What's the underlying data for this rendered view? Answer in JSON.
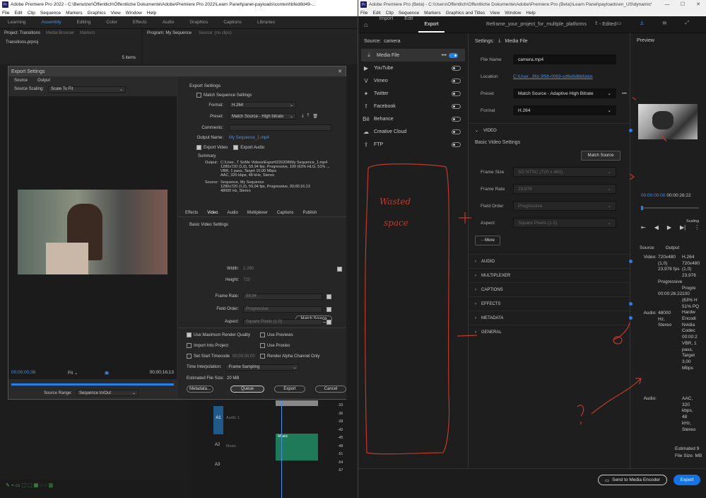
{
  "left_window": {
    "title": "Adobe Premiere Pro 2022 - C:\\Benutzer\\Öffentlich\\Öffentliche Dokumente\\Adobe\\Premiere Pro 2022\\Learn Panel\\panel-payloads\\content\\bfed8d49-...",
    "menu": [
      "File",
      "Edit",
      "Clip",
      "Sequence",
      "Markers",
      "Graphics",
      "View",
      "Window",
      "Help"
    ],
    "workspaces": [
      "Learning",
      "Assembly",
      "Editing",
      "Color",
      "Effects",
      "Audio",
      "Graphics",
      "Captions",
      "Libraries"
    ],
    "active_workspace": "Assembly",
    "project_tabs": [
      "Project: Transitions",
      "Media Browser",
      "Markers"
    ],
    "program_tabs": [
      "Program: My Sequence",
      "Source: (no clips)"
    ],
    "project_file": "Transitions.prproj",
    "items_count": "5 items",
    "export_dialog": {
      "title": "Export Settings",
      "tabs": [
        "Source",
        "Output"
      ],
      "source_scaling_label": "Source Scaling:",
      "source_scaling_value": "Scale To Fit",
      "timecode_left": "00;00;00;38",
      "fit": "Fit",
      "timecode_right": "00;00;16;13",
      "source_range_label": "Source Range:",
      "source_range_value": "Sequence In/Out",
      "export_settings_header": "Export Settings",
      "match_sequence": "Match Sequence Settings",
      "format_label": "Format:",
      "format_value": "H.264",
      "preset_label": "Preset:",
      "preset_value": "Match Source - High bitrate",
      "comments_label": "Comments:",
      "output_name_label": "Output Name:",
      "output_name_value": "My Sequence_1.mp4",
      "export_video": "Export Video",
      "export_audio": "Export Audio",
      "summary_header": "Summary",
      "output_label": "Output:",
      "output_lines": [
        "C:\\User...T SoMe Videos\\Export\\220208\\My Sequence_1.mp4",
        "1280x720 (1,0), 59,94 fps, Progressive, 100 (63% HLG, 51% ...",
        "VBR, 1 pass, Target 10,00 Mbps",
        "AAC, 320 kbps, 48 kHz, Stereo"
      ],
      "source_label": "Source:",
      "source_lines": [
        "Sequence, My Sequence",
        "1280x720 (1,0), 59,94 fps, Progressive, 00;00;16;13",
        "48000 Hz, Stereo"
      ],
      "settings_tabs": [
        "Effects",
        "Video",
        "Audio",
        "Multiplexer",
        "Captions",
        "Publish"
      ],
      "active_settings_tab": "Video",
      "basic_video_header": "Basic Video Settings",
      "match_source_btn": "Match Source",
      "width_label": "Width:",
      "width_value": "1.280",
      "height_label": "Height:",
      "height_value": "720",
      "frame_rate_label": "Frame Rate:",
      "frame_rate_value": "59,94",
      "field_order_label": "Field Order:",
      "field_order_value": "Progressive",
      "aspect_label": "Aspect:",
      "aspect_value": "Square Pixels (1.0)",
      "max_render": "Use Maximum Render Quality",
      "use_previews": "Use Previews",
      "import_project": "Import Into Project",
      "use_proxies": "Use Proxies",
      "set_start_tc": "Set Start Timecode",
      "start_tc_value": "00;00;00;00",
      "render_alpha": "Render Alpha Channel Only",
      "time_interp_label": "Time Interpolation:",
      "time_interp_value": "Frame Sampling",
      "file_size_label": "Estimated File Size:",
      "file_size_value": "20 MB",
      "buttons": [
        "Metadata...",
        "Queue",
        "Export",
        "Cancel"
      ]
    },
    "timeline": {
      "tracks": [
        "A1",
        "A2",
        "A3"
      ],
      "track_labels": [
        "Audio 1",
        "Music"
      ],
      "clip_label": "Music",
      "db_scale": [
        "-33",
        "-36",
        "-39",
        "-42",
        "-45",
        "-48",
        "-51",
        "-54",
        "-57"
      ]
    }
  },
  "right_window": {
    "title": "Adobe Premiere Pro (Beta) - C:\\Users\\Öffentlich\\Öffentliche Dokumente\\Adobe\\Premiere Pro (Beta)\\Learn Panel\\payloads\\en_US\\dynamic\\conte...",
    "menu": [
      "File",
      "Edit",
      "Clip",
      "Sequence",
      "Markers",
      "Graphics and Titles",
      "View",
      "Window",
      "Help"
    ],
    "tabs": [
      "Import",
      "Edit",
      "Export"
    ],
    "active_tab": "Export",
    "project_title": "Reframe_your_project_for_multiple_platforms",
    "edited_status": "- Edited",
    "source_label": "Source:",
    "source_value": "camera",
    "destinations": [
      {
        "label": "Media File",
        "icon": "download-icon",
        "on": true
      },
      {
        "label": "YouTube",
        "icon": "youtube-icon",
        "on": false
      },
      {
        "label": "Vimeo",
        "icon": "vimeo-icon",
        "on": false
      },
      {
        "label": "Twitter",
        "icon": "twitter-icon",
        "on": false
      },
      {
        "label": "Facebook",
        "icon": "facebook-icon",
        "on": false
      },
      {
        "label": "Behance",
        "icon": "behance-icon",
        "on": false
      },
      {
        "label": "Creative Cloud",
        "icon": "creative-cloud-icon",
        "on": false
      },
      {
        "label": "FTP",
        "icon": "ftp-icon",
        "on": false
      }
    ],
    "settings_label": "Settings:",
    "settings_value": "Media File",
    "file_name_label": "File Name",
    "file_name_value": "camera.mp4",
    "location_label": "Location",
    "location_value": "C:\\User...8fd-3f98-0083-cd6e6d8bfdda\\",
    "preset_label": "Preset",
    "preset_value": "Match Source - Adaptive High Bitrate",
    "format_label": "Format",
    "format_value": "H.264",
    "video_section": "VIDEO",
    "basic_video": "Basic Video Settings",
    "match_source": "Match Source",
    "frame_size_label": "Frame Size",
    "frame_size_value": "SD NTSC (720 x 480)",
    "frame_rate_label": "Frame Rate",
    "frame_rate_value": "23,976",
    "field_order_label": "Field Order",
    "field_order_value": "Progressive",
    "aspect_label": "Aspect",
    "aspect_value": "Square Pixels (1.0)",
    "more_btn": "More",
    "sections": [
      "AUDIO",
      "MULTIPLEXER",
      "CAPTIONS",
      "EFFECTS",
      "METADATA",
      "GENERAL"
    ],
    "preview_label": "Preview",
    "preview_tc_start": "00:00:00:00",
    "preview_tc_end": "00:00:26:22",
    "scaling_label": "Scaling",
    "summary_cols": [
      "Source",
      "Output"
    ],
    "video_label": "Video:",
    "src_video": [
      "720x480",
      "(1,0)",
      "23,976 fps",
      "",
      "Progressive",
      "",
      "00:00:26:22"
    ],
    "out_video": [
      "H.264",
      "720x480",
      "(1,0)",
      "23,976",
      "",
      "Progre",
      "100",
      "(63% H",
      "51% PQ",
      "Hardw",
      "Encodi",
      "Nvidia",
      "Codec",
      "00:00:2",
      "VBR, 1",
      "pass,",
      "Target",
      "3,00",
      "Mbps"
    ],
    "audio_label": "Audio:",
    "src_audio": [
      "48000",
      "Hz,",
      "Stereo"
    ],
    "out_audio": [
      "AAC,",
      "320",
      "kbps,",
      "48",
      "kHz,",
      "Stereo"
    ],
    "estimated_label": "Estimated",
    "estimated_value": "9",
    "filesize_label": "File Size:",
    "filesize_value": "MB",
    "send_btn": "Send to Media Encoder",
    "export_btn": "Export",
    "annotation": [
      "Wasted",
      "space"
    ]
  }
}
